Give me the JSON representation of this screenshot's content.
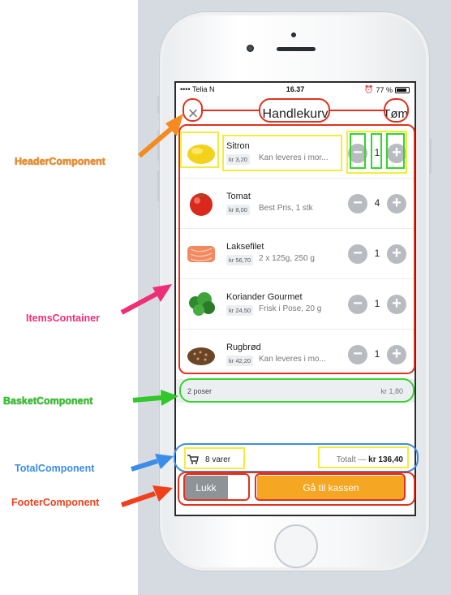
{
  "status_bar": {
    "carrier": "•••• Telia N",
    "time": "16.37",
    "battery": "77 %"
  },
  "header": {
    "close_icon": "close-icon",
    "title": "Handlekurv",
    "clear_label": "Tøm"
  },
  "items": [
    {
      "name": "Sitron",
      "price": "kr 3,20",
      "description": "Kan leveres i mor...",
      "quantity": "1",
      "image": "lemon"
    },
    {
      "name": "Tomat",
      "price": "kr 8,00",
      "description": "Best Pris, 1 stk",
      "quantity": "4",
      "image": "tomato"
    },
    {
      "name": "Laksefilet",
      "price": "kr 56,70",
      "description": "2 x 125g, 250 g",
      "quantity": "1",
      "image": "salmon"
    },
    {
      "name": "Koriander Gourmet",
      "price": "kr 24,50",
      "description": "Frisk i Pose, 20 g",
      "quantity": "1",
      "image": "coriander"
    },
    {
      "name": "Rugbrød",
      "price": "kr 42,20",
      "description": "Kan leveres i mo...",
      "quantity": "1",
      "image": "bread"
    }
  ],
  "basket": {
    "label": "2 poser",
    "price": "kr 1,80"
  },
  "total": {
    "count": "8 varer",
    "label": "Totalt —",
    "amount": "kr 136,40"
  },
  "footer": {
    "close_label": "Lukk",
    "checkout_label": "Gå til kassen"
  },
  "annotations": {
    "header": "HeaderComponent",
    "items": "ItemsContainer",
    "basket": "BasketComponent",
    "total": "TotalComponent",
    "footer": "FooterComponent"
  },
  "colors": {
    "header_label": "#f58a1f",
    "items_label": "#ee2f77",
    "basket_label": "#32c72a",
    "total_label": "#3b8de8",
    "footer_label": "#f0401b",
    "checkout": "#f5a623",
    "close_button": "#8e9398"
  }
}
